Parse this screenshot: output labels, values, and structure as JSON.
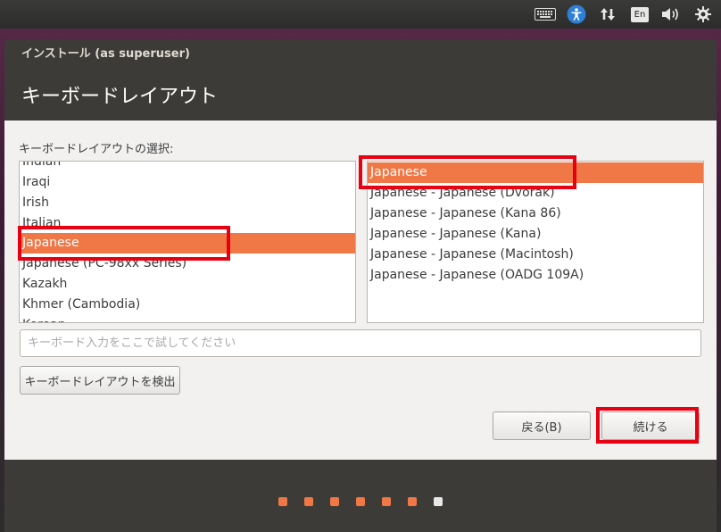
{
  "top_panel": {
    "keyboard_icon": "keyboard-icon",
    "accessibility_icon": "accessibility-icon",
    "network_icon": "network-updown-icon",
    "language_label": "En",
    "volume_icon": "volume-icon",
    "settings_icon": "gear-icon"
  },
  "window": {
    "title": "インストール (as superuser)",
    "page_header": "キーボードレイアウト"
  },
  "layout": {
    "section_label": "キーボードレイアウトの選択:",
    "left_list": [
      "Indian",
      "Iraqi",
      "Irish",
      "Italian",
      "Japanese",
      "Japanese (PC-98xx Series)",
      "Kazakh",
      "Khmer (Cambodia)",
      "Korean"
    ],
    "left_selected": "Japanese",
    "right_list": [
      "Japanese",
      "Japanese - Japanese (Dvorak)",
      "Japanese - Japanese (Kana 86)",
      "Japanese - Japanese (Kana)",
      "Japanese - Japanese (Macintosh)",
      "Japanese - Japanese (OADG 109A)"
    ],
    "right_selected": "Japanese",
    "test_placeholder": "キーボード入力をここで試してください",
    "detect_button": "キーボードレイアウトを検出"
  },
  "buttons": {
    "back": "戻る(B)",
    "continue": "続ける"
  },
  "progress": {
    "total_steps": 7,
    "current_step": 7
  },
  "colors": {
    "accent": "#f07746",
    "highlight_box": "#e60012"
  }
}
